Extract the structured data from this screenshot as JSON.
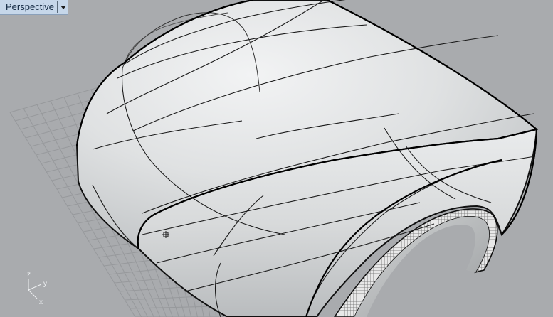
{
  "viewport": {
    "title": "Perspective",
    "menu_icon": "chevron-down-icon"
  },
  "axes": {
    "z": "z",
    "y": "y",
    "x": "x"
  },
  "colors": {
    "background": "#a9abae",
    "grid": "#96999c",
    "surface_light": "#eceeef",
    "surface_mid": "#cfd2d4",
    "surface_dark": "#8e9193",
    "edge": "#111111",
    "title_bar": "#c6d7ea"
  }
}
